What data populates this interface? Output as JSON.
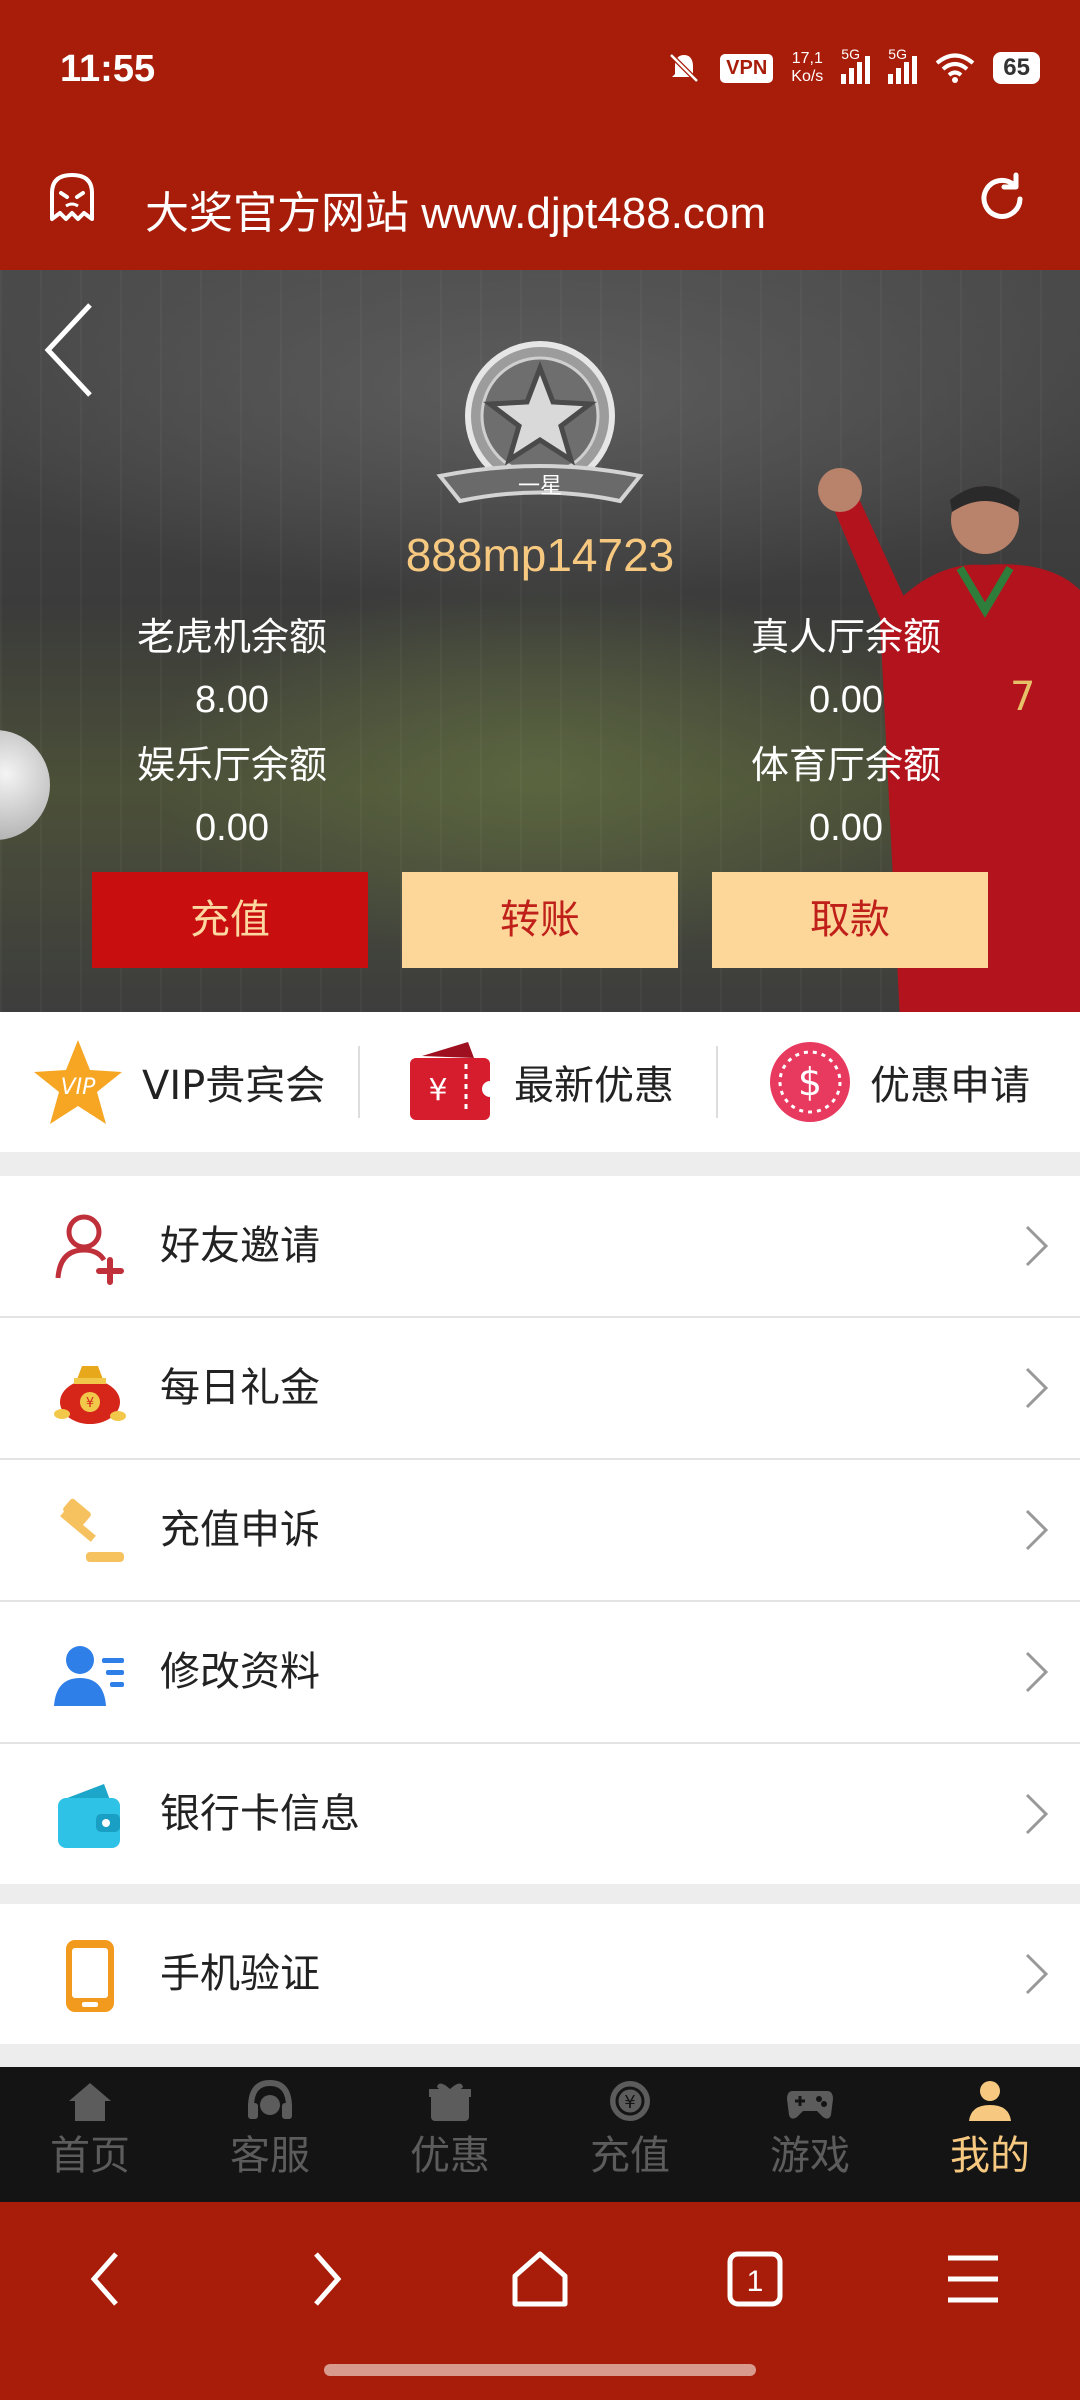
{
  "statusbar": {
    "time": "11:55",
    "vpn": "VPN",
    "net_speed_top": "17,1",
    "net_speed_bottom": "Ko/s",
    "sig1_label": "5G",
    "sig2_label": "5G",
    "battery": "65"
  },
  "browser": {
    "url_text": "大奖官方网站 www.djpt488.com"
  },
  "account": {
    "level_badge": "一星",
    "username": "888mp14723",
    "balances": [
      {
        "label": "老虎机余额",
        "value": "8.00"
      },
      {
        "label": "真人厅余额",
        "value": "0.00"
      },
      {
        "label": "娱乐厅余额",
        "value": "0.00"
      },
      {
        "label": "体育厅余额",
        "value": "0.00"
      }
    ],
    "buttons": {
      "deposit": "充值",
      "transfer": "转账",
      "withdraw": "取款"
    }
  },
  "quick_links": [
    {
      "label": "VIP贵宾会",
      "icon": "vip-star-icon"
    },
    {
      "label": "最新优惠",
      "icon": "ticket-icon"
    },
    {
      "label": "优惠申请",
      "icon": "dollar-coin-icon"
    }
  ],
  "menu": [
    {
      "label": "好友邀请",
      "icon": "add-friend-icon"
    },
    {
      "label": "每日礼金",
      "icon": "money-bag-icon"
    },
    {
      "label": "充值申诉",
      "icon": "gavel-icon"
    },
    {
      "label": "修改资料",
      "icon": "user-edit-icon"
    },
    {
      "label": "银行卡信息",
      "icon": "wallet-icon"
    },
    {
      "label": "手机验证",
      "icon": "phone-icon"
    }
  ],
  "tabbar": [
    {
      "label": "首页",
      "icon": "home-icon"
    },
    {
      "label": "客服",
      "icon": "headset-icon"
    },
    {
      "label": "优惠",
      "icon": "gift-icon"
    },
    {
      "label": "充值",
      "icon": "yen-coin-icon"
    },
    {
      "label": "游戏",
      "icon": "gamepad-icon"
    },
    {
      "label": "我的",
      "icon": "user-icon",
      "active": true
    }
  ],
  "browser_nav": {
    "tab_count": "1"
  },
  "colors": {
    "brand_red": "#a71d0a",
    "gold": "#f7c980",
    "button_yellow": "#fdd69a",
    "button_red": "#c80e0e"
  }
}
